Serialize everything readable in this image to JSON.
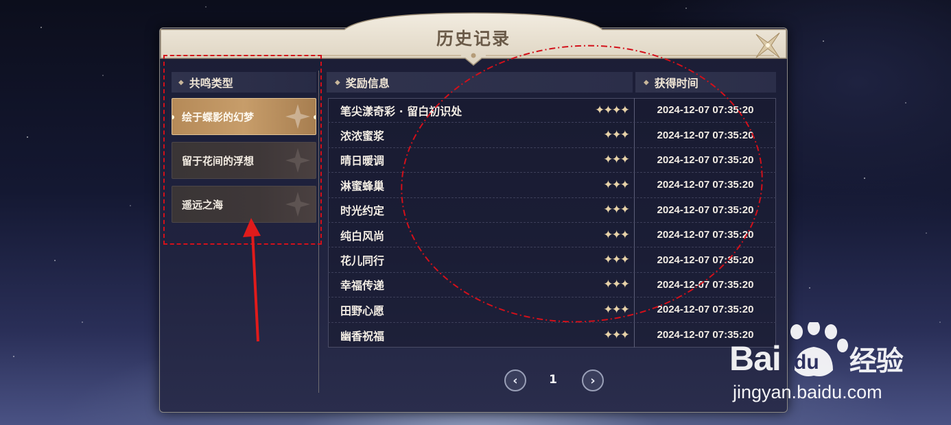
{
  "dialog": {
    "title": "历史记录"
  },
  "left_panel": {
    "header": "共鸣类型",
    "types": [
      {
        "label": "绘于蝶影的幻梦",
        "active": true
      },
      {
        "label": "留于花间的浮想",
        "active": false
      },
      {
        "label": "遥远之海",
        "active": false
      }
    ]
  },
  "table": {
    "col_reward": "奖励信息",
    "col_time": "获得时间",
    "rows": [
      {
        "name": "笔尖漾奇彩 · 留白初识处",
        "stars": "✦✦✦✦",
        "time": "2024-12-07 07:35:20"
      },
      {
        "name": "浓浓蜜浆",
        "stars": "✦✦✦",
        "time": "2024-12-07 07:35:20"
      },
      {
        "name": "晴日暖调",
        "stars": "✦✦✦",
        "time": "2024-12-07 07:35:20"
      },
      {
        "name": "淋蜜蜂巢",
        "stars": "✦✦✦",
        "time": "2024-12-07 07:35:20"
      },
      {
        "name": "时光约定",
        "stars": "✦✦✦",
        "time": "2024-12-07 07:35:20"
      },
      {
        "name": "纯白风尚",
        "stars": "✦✦✦",
        "time": "2024-12-07 07:35:20"
      },
      {
        "name": "花儿同行",
        "stars": "✦✦✦",
        "time": "2024-12-07 07:35:20"
      },
      {
        "name": "幸福传递",
        "stars": "✦✦✦",
        "time": "2024-12-07 07:35:20"
      },
      {
        "name": "田野心愿",
        "stars": "✦✦✦",
        "time": "2024-12-07 07:35:20"
      },
      {
        "name": "幽香祝福",
        "stars": "✦✦✦",
        "time": "2024-12-07 07:35:20"
      }
    ]
  },
  "pagination": {
    "prev_icon": "chevron-left-icon",
    "next_icon": "chevron-right-icon",
    "page": "1"
  },
  "watermark": {
    "brand": "Bai",
    "brand_du": "du",
    "brand_cn": "经验",
    "url": "jingyan.baidu.com"
  },
  "colors": {
    "accent_gold": "#c79d6a",
    "annotation_red": "#d3101a",
    "panel_bg": "#1b1d35"
  }
}
